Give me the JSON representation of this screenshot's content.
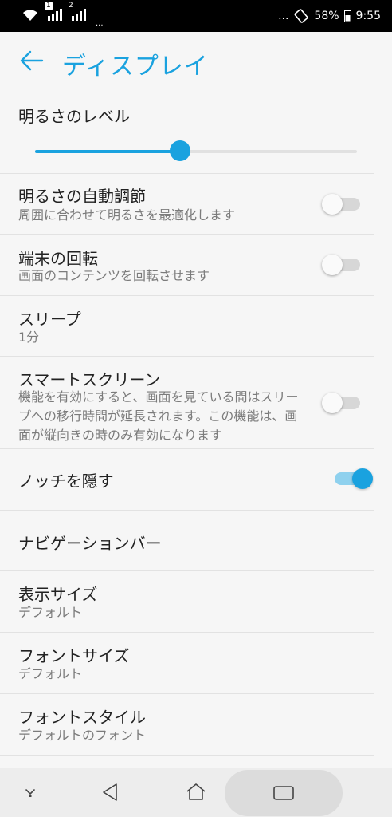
{
  "status_bar": {
    "sim1": "1",
    "sim2": "2",
    "extra_dots": "...",
    "overflow_dots": "...",
    "battery": "58%",
    "time": "9:55"
  },
  "header": {
    "title": "ディスプレイ"
  },
  "brightness": {
    "label": "明るさのレベル",
    "level": 0.45
  },
  "settings": [
    {
      "title": "明るさの自動調節",
      "subtitle": "周囲に合わせて明るさを最適化します",
      "toggle": "off"
    },
    {
      "title": "端末の回転",
      "subtitle": "画面のコンテンツを回転させます",
      "toggle": "off"
    },
    {
      "title": "スリープ",
      "subtitle": "1分"
    },
    {
      "title": "スマートスクリーン",
      "subtitle": "機能を有効にすると、画面を見ている間はスリープへの移行時間が延長されます。この機能は、画面が縦向きの時のみ有効になります",
      "toggle": "off"
    },
    {
      "title": "ノッチを隠す",
      "toggle": "on"
    },
    {
      "title": "ナビゲーションバー"
    },
    {
      "title": "表示サイズ",
      "subtitle": "デフォルト"
    },
    {
      "title": "フォントサイズ",
      "subtitle": "デフォルト"
    },
    {
      "title": "フォントスタイル",
      "subtitle": "デフォルトのフォント"
    }
  ],
  "colors": {
    "accent": "#1aa2df",
    "accent_light": "#8fd1ee"
  }
}
